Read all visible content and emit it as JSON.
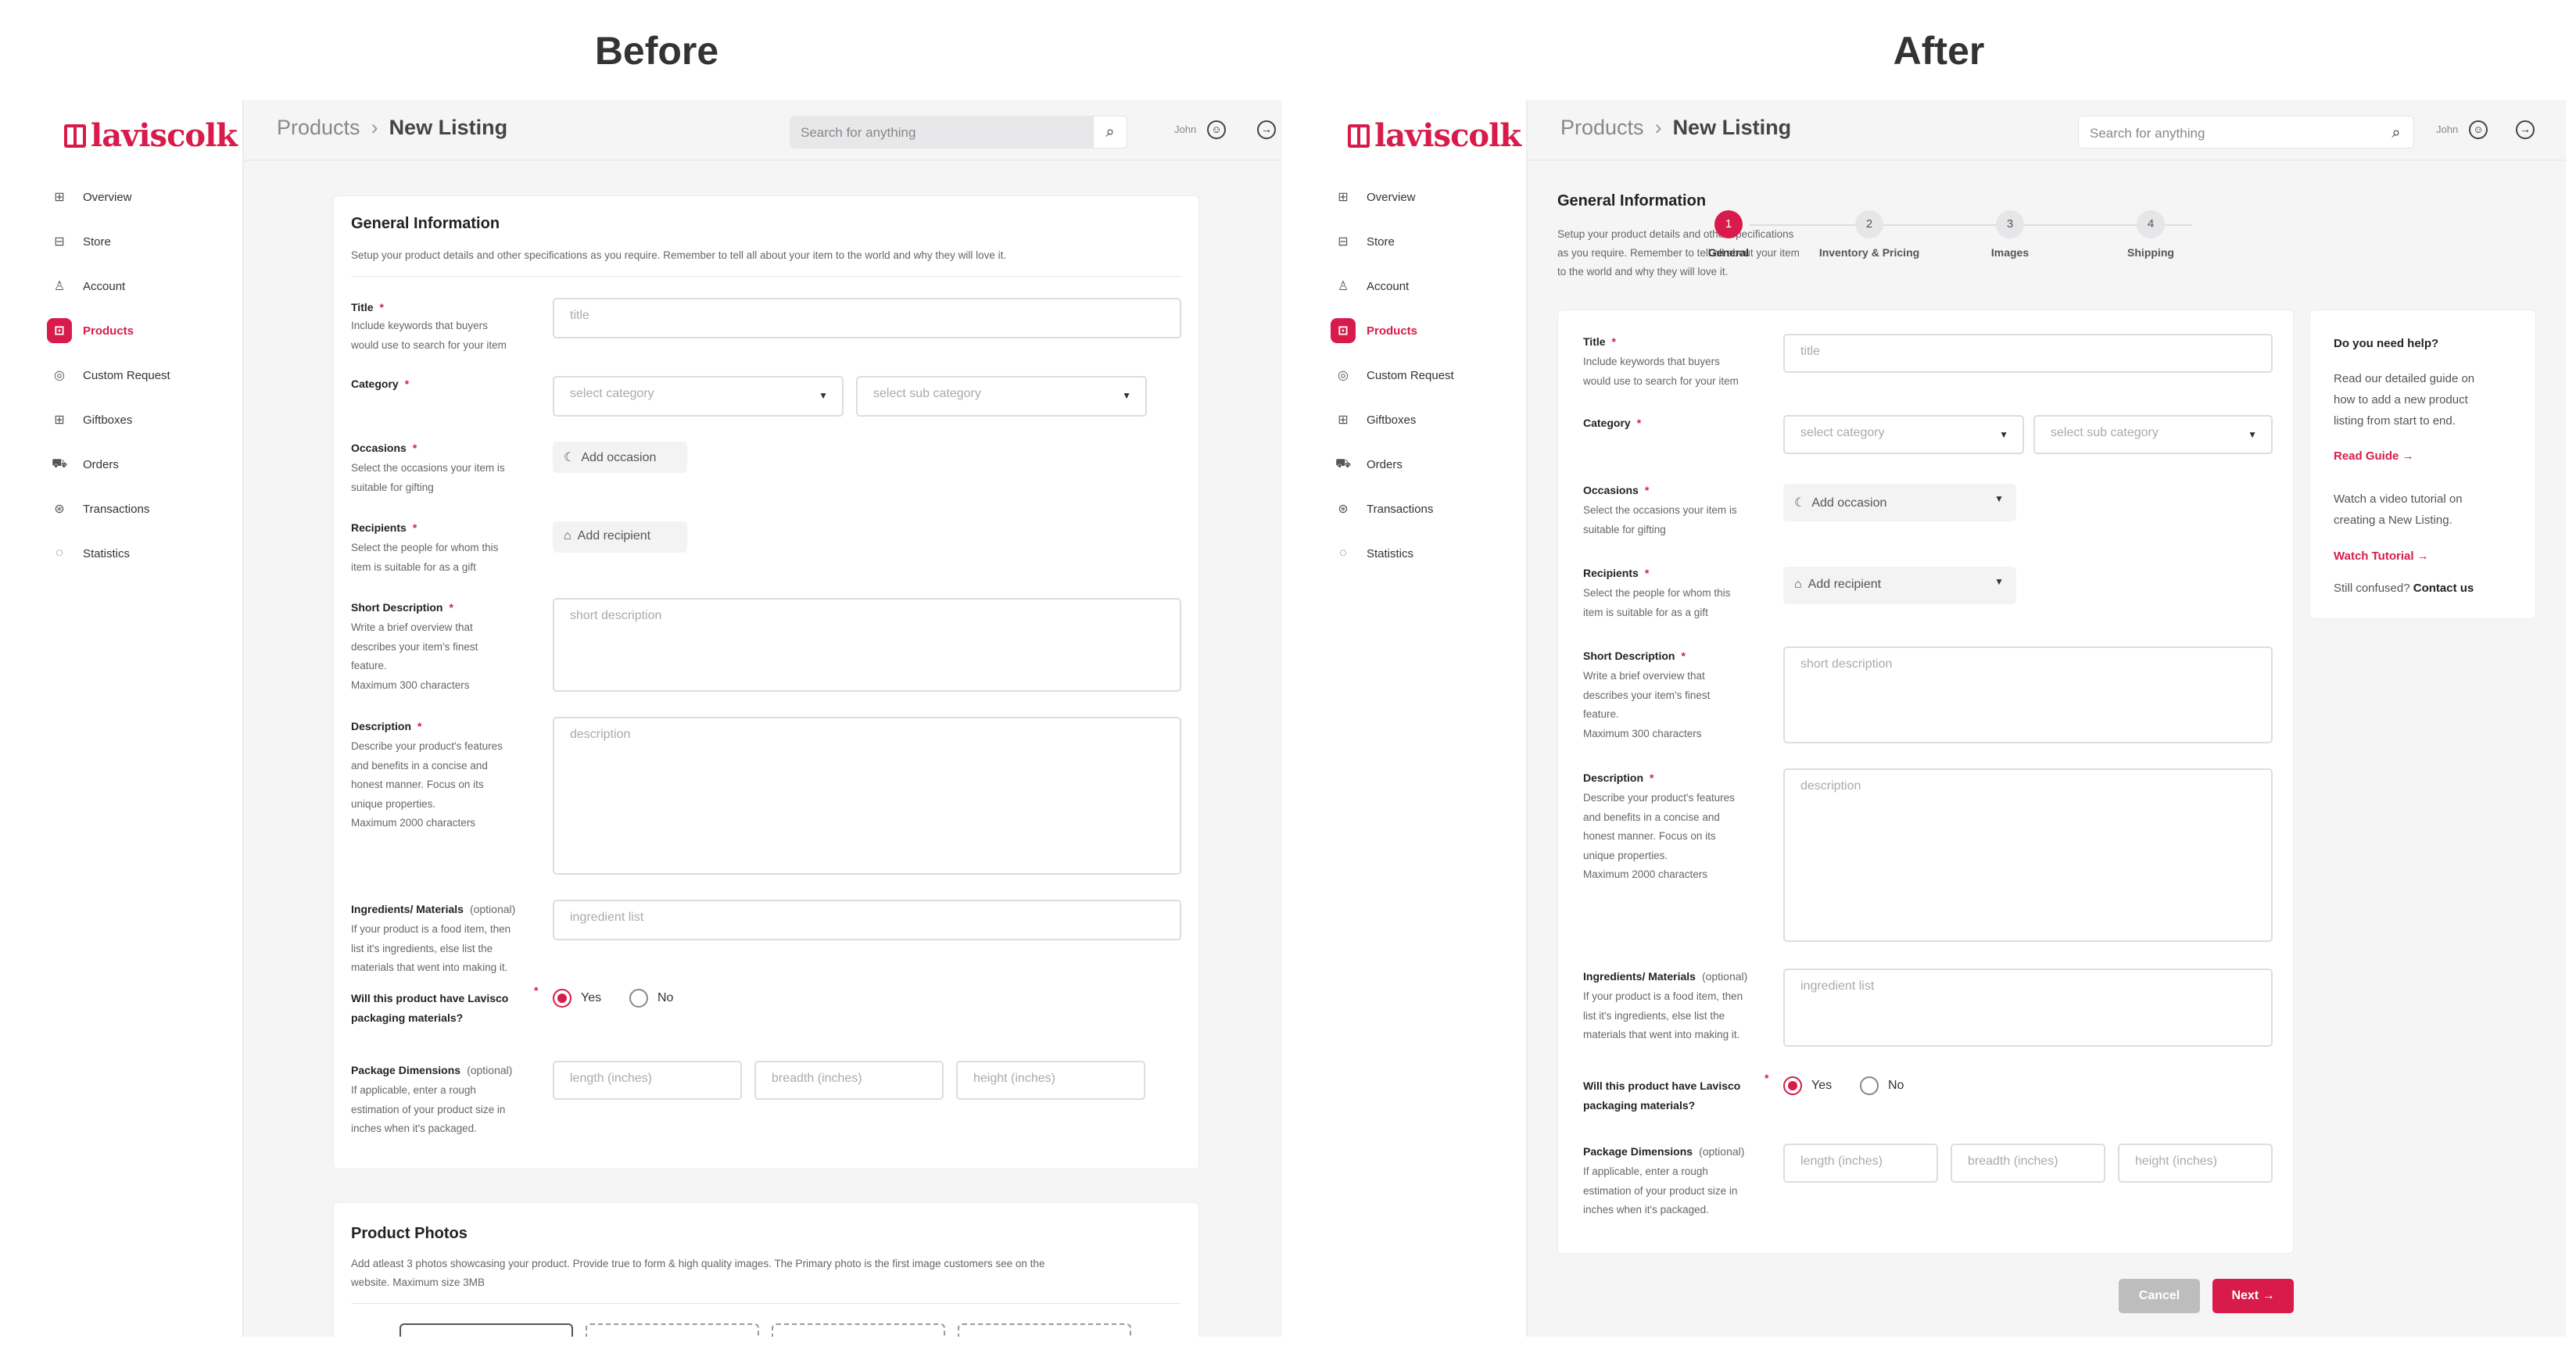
{
  "headings": {
    "before": "Before",
    "after": "After"
  },
  "app": {
    "logo": "laviscolk"
  },
  "nav": [
    {
      "label": "Overview",
      "icon": "grid-icon"
    },
    {
      "label": "Store",
      "icon": "store-icon"
    },
    {
      "label": "Account",
      "icon": "account-icon"
    },
    {
      "label": "Products",
      "icon": "products-icon",
      "active": true
    },
    {
      "label": "Custom Request",
      "icon": "custom-request-icon"
    },
    {
      "label": "Giftboxes",
      "icon": "giftbox-icon"
    },
    {
      "label": "Orders",
      "icon": "truck-icon"
    },
    {
      "label": "Transactions",
      "icon": "transactions-icon"
    },
    {
      "label": "Statistics",
      "icon": "statistics-icon"
    }
  ],
  "breadcrumb": {
    "parent": "Products",
    "current": "New Listing"
  },
  "search": {
    "placeholder": "Search for anything"
  },
  "user": {
    "name": "John"
  },
  "general": {
    "title": "General Information",
    "desc": "Setup your product details and other specifications as you require. Remember to tell all about your item to the world and why they will love it.",
    "desc_after_1": "Setup your product details and other specifications",
    "desc_after_2": "as you require. Remember to tell all about your item",
    "desc_after_3": "to the world and why they will love it."
  },
  "fields": {
    "title": {
      "label": "Title",
      "help_1": "Include keywords that buyers",
      "help_2": "would use to search for your item",
      "placeholder": "title"
    },
    "category": {
      "label": "Category",
      "placeholder": "select category",
      "sub_placeholder": "select sub category"
    },
    "occasions": {
      "label": "Occasions",
      "help_1": "Select the occasions your item is",
      "help_2": "suitable for gifting",
      "button": "Add occasion"
    },
    "recipients": {
      "label": "Recipients",
      "help_1": "Select the people for whom this",
      "help_2": "item is suitable for as a gift",
      "button": "Add recipient"
    },
    "short_desc": {
      "label": "Short Description",
      "help_1": "Write a brief overview that",
      "help_2": "describes your item's finest",
      "help_3": "feature.",
      "help_4": "Maximum 300 characters",
      "placeholder": "short description"
    },
    "description": {
      "label": "Description",
      "help_1": "Describe your product's features",
      "help_2": "and benefits in a concise and",
      "help_3": "honest manner. Focus on its",
      "help_4": "unique properties.",
      "help_5": "Maximum 2000 characters",
      "placeholder": "description"
    },
    "ingredients": {
      "label": "Ingredients/ Materials",
      "optional": "(optional)",
      "help_1": "If your product is a food item, then",
      "help_2": "list it's ingredients, else list the",
      "help_3": "materials that went into making it.",
      "placeholder": "ingredient list"
    },
    "packaging": {
      "label_1": "Will this product have Lavisco",
      "label_2": "packaging  materials?",
      "yes": "Yes",
      "no": "No"
    },
    "dimensions": {
      "label": "Package Dimensions",
      "optional": "(optional)",
      "help_1": "If applicable, enter a rough",
      "help_2": "estimation of your product size in",
      "help_3": "inches when it's packaged.",
      "length": "length (inches)",
      "breadth": "breadth (inches)",
      "height": "height (inches)"
    }
  },
  "photos": {
    "title": "Product Photos",
    "desc_1": "Add atleast 3 photos showcasing your product. Provide true to form & high quality images. The Primary photo is the first image customers see on the",
    "desc_2": "website. Maximum size 3MB"
  },
  "steps": [
    {
      "num": "1",
      "label": "General"
    },
    {
      "num": "2",
      "label": "Inventory & Pricing"
    },
    {
      "num": "3",
      "label": "Images"
    },
    {
      "num": "4",
      "label": "Shipping"
    }
  ],
  "help": {
    "title": "Do you need help?",
    "guide_1": "Read our detailed guide on",
    "guide_2": "how to add a new product",
    "guide_3": "listing from start to end.",
    "guide_link": "Read Guide →",
    "video_1": "Watch a video tutorial on",
    "video_2": "creating a New Listing.",
    "video_link": "Watch Tutorial →",
    "confused": "Still confused?",
    "contact": "Contact us"
  },
  "actions": {
    "cancel": "Cancel",
    "next": "Next →"
  },
  "colors": {
    "accent": "#d81b4a",
    "background": "#f5f5f6"
  }
}
